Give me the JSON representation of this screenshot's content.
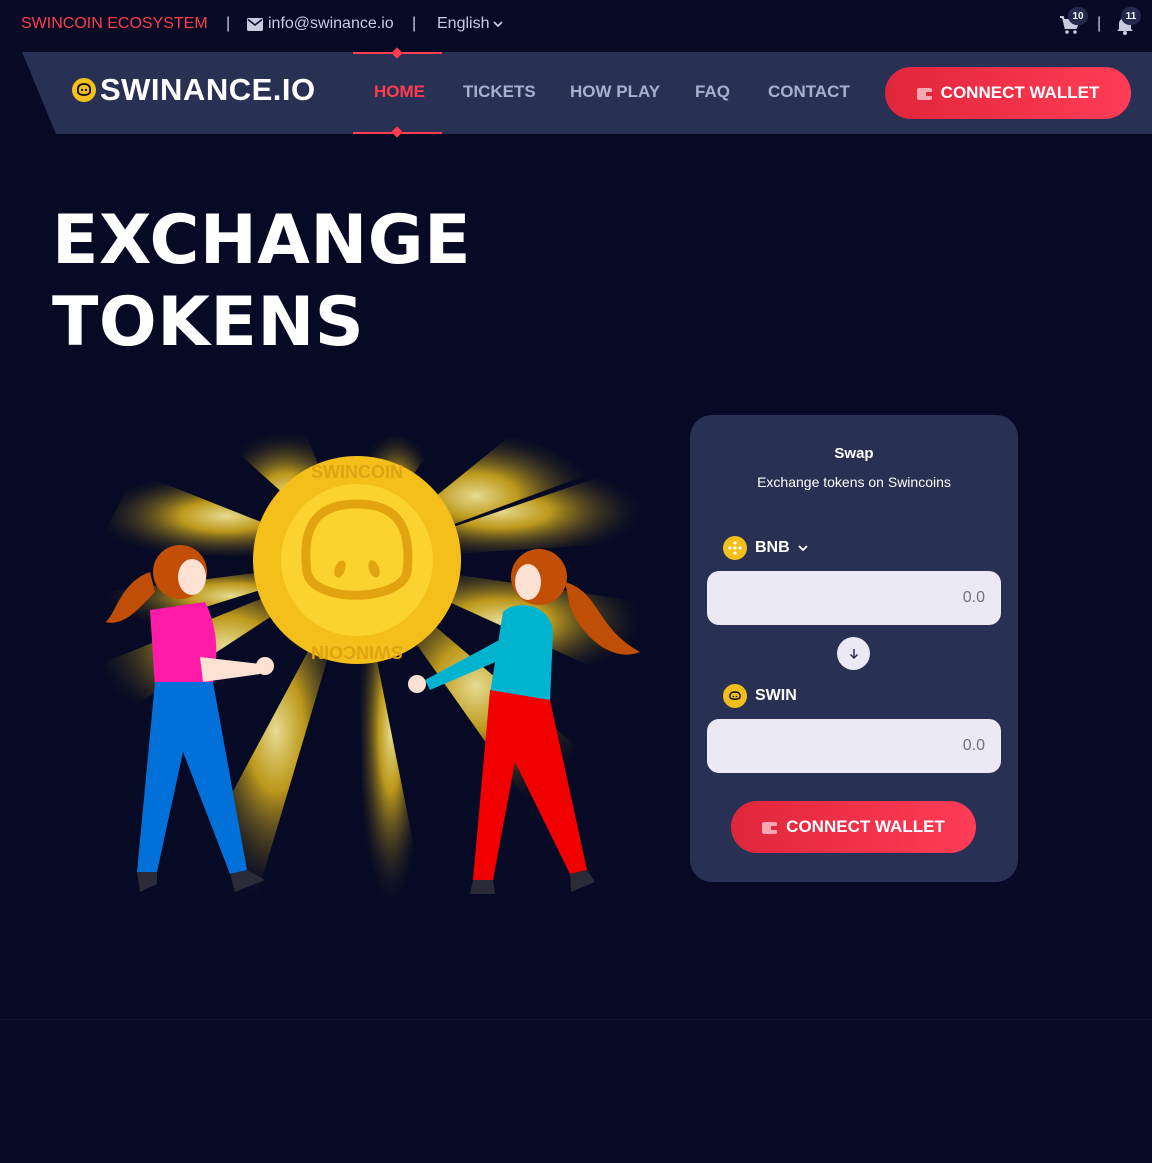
{
  "topbar": {
    "ecosystem_label": "SWINCOIN ECOSYSTEM",
    "separator": "|",
    "email": "info@swinance.io",
    "language": "English",
    "cart_count": "10",
    "notification_count": "11"
  },
  "nav": {
    "logo_text": "SWINANCE.IO",
    "links": [
      "HOME",
      "TICKETS",
      "HOW PLAY",
      "FAQ",
      "CONTACT"
    ],
    "active": "HOME",
    "connect_wallet_label": "CONNECT WALLET"
  },
  "hero": {
    "title_line1": "EXCHANGE",
    "title_line2": "TOKENS",
    "coin_text": "SWINCOIN"
  },
  "swap": {
    "title": "Swap",
    "subtitle": "Exchange tokens on Swincoins",
    "from_token": "BNB",
    "from_placeholder": "0.0",
    "to_token": "SWIN",
    "to_placeholder": "0.0",
    "connect_wallet_label": "CONNECT WALLET"
  },
  "colors": {
    "background": "#070a24",
    "nav_bg": "#283054",
    "accent_red": "#ff3d4f",
    "coin_yellow": "#f4bf1a",
    "input_bg": "#ebe9f4"
  },
  "icons": [
    "envelope-icon",
    "chevron-down-icon",
    "cart-icon",
    "bell-icon",
    "wallet-icon",
    "bnb-icon",
    "swin-icon",
    "arrow-down-icon"
  ]
}
